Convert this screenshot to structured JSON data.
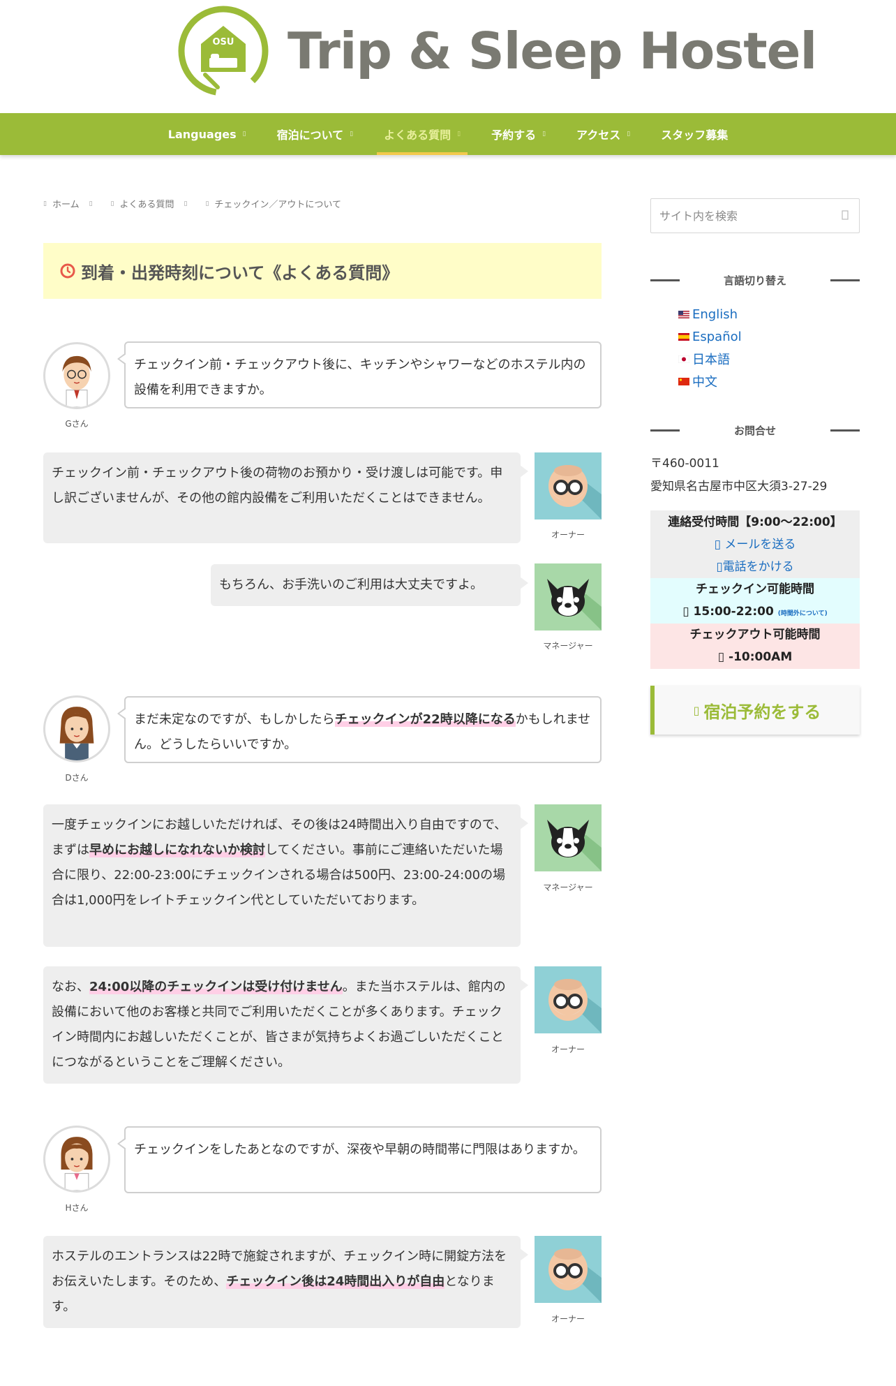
{
  "site": {
    "logo_badge": "OSU",
    "title": "Trip & Sleep Hostel"
  },
  "nav": {
    "items": [
      {
        "label": "Languages",
        "caret": "▯"
      },
      {
        "label": "宿泊について",
        "caret": "▯"
      },
      {
        "label": "よくある質問",
        "caret": "▯"
      },
      {
        "label": "予約する",
        "caret": "▯"
      },
      {
        "label": "アクセス",
        "caret": "▯"
      },
      {
        "label": "スタッフ募集",
        "caret": ""
      }
    ],
    "active_index": 2
  },
  "breadcrumb": {
    "icon": "▯",
    "items": [
      "ホーム",
      "よくある質問",
      "チェックイン／アウトについて"
    ]
  },
  "page_title": "到着・出発時刻について《よくある質問》",
  "conversation": {
    "q1": {
      "name": "Gさん",
      "text": "チェックイン前・チェックアウト後に、キッチンやシャワーなどのホステル内の設備を利用できますか。"
    },
    "a1": {
      "name": "オーナー",
      "text": "チェックイン前・チェックアウト後の荷物のお預かり・受け渡しは可能です。申し訳ございませんが、その他の館内設備をご利用いただくことはできません。"
    },
    "a2": {
      "name": "マネージャー",
      "text": "もちろん、お手洗いのご利用は大丈夫ですよ。"
    },
    "q2": {
      "name": "Dさん",
      "text_before": "まだ未定なのですが、もしかしたら",
      "highlight": "チェックインが22時以降になる",
      "text_after": "かもしれません。どうしたらいいですか。"
    },
    "a3": {
      "name": "マネージャー",
      "text_before": "一度チェックインにお越しいただければ、その後は24時間出入り自由ですので、まずは",
      "highlight": "早めにお越しになれないか検討",
      "text_after": "してください。事前にご連絡いただいた場合に限り、22:00-23:00にチェックインされる場合は500円、23:00-24:00の場合は1,000円をレイトチェックイン代としていただいております。"
    },
    "a4": {
      "name": "オーナー",
      "text_before": "なお、",
      "highlight": "24:00以降のチェックインは受け付けません",
      "text_after": "。また当ホステルは、館内の設備において他のお客様と共同でご利用いただくことが多くあります。チェックイン時間内にお越しいただくことが、皆さまが気持ちよくお過ごしいただくことにつながるということをご理解ください。"
    },
    "q3": {
      "name": "Hさん",
      "text": "チェックインをしたあとなのですが、深夜や早朝の時間帯に門限はありますか。"
    },
    "a5": {
      "name": "オーナー",
      "text_before": "ホステルのエントランスは22時で施錠されますが、チェックイン時に開錠方法をお伝えいたします。そのため、",
      "highlight": "チェックイン後は24時間出入りが自由",
      "text_after": "となります。"
    }
  },
  "sidebar": {
    "search_placeholder": "サイト内を検索",
    "search_icon_glyph": "▯",
    "lang_title": "言語切り替え",
    "languages": [
      "English",
      "Español",
      "日本語",
      "中文"
    ],
    "contact_title": "お問合せ",
    "postal": "〒460-0011",
    "address": "愛知県名古屋市中区大須3-27-29",
    "reception_hours": "連絡受付時間【9:00〜22:00】",
    "mail_label": "メールを送る",
    "phone_label": "電話をかける",
    "link_icon": "▯",
    "checkin_title": "チェックイン可能時間",
    "checkin_time": "15:00-22:00",
    "checkin_note": "(時間外について)",
    "checkout_title": "チェックアウト可能時間",
    "checkout_time": "-10:00AM",
    "reserve_label": "宿泊予約をする"
  },
  "colors": {
    "brand_green": "#9bbb38",
    "logo_gray": "#7a7a72",
    "title_bg": "#fffdc8",
    "highlight": "#ffcfe6",
    "link_blue": "#1a6dc0"
  }
}
